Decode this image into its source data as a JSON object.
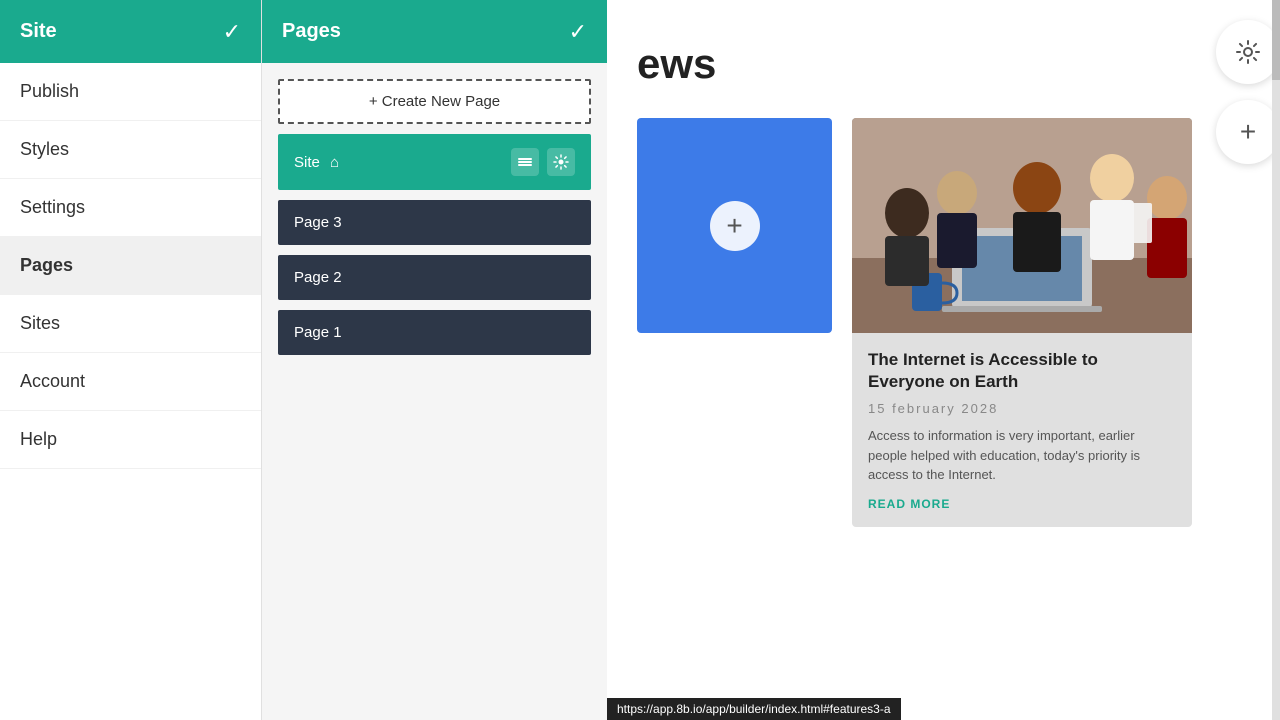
{
  "sidebar": {
    "title": "Site",
    "check": "✓",
    "items": [
      {
        "id": "publish",
        "label": "Publish",
        "active": false
      },
      {
        "id": "styles",
        "label": "Styles",
        "active": false
      },
      {
        "id": "settings",
        "label": "Settings",
        "active": false
      },
      {
        "id": "pages",
        "label": "Pages",
        "active": true
      },
      {
        "id": "sites",
        "label": "Sites",
        "active": false
      },
      {
        "id": "account",
        "label": "Account",
        "active": false
      },
      {
        "id": "help",
        "label": "Help",
        "active": false
      }
    ]
  },
  "pages_panel": {
    "title": "Pages",
    "check": "✓",
    "create_btn_label": "+ Create New Page",
    "pages": [
      {
        "id": "site",
        "label": "Site",
        "is_site": true
      },
      {
        "id": "page3",
        "label": "Page 3",
        "is_site": false
      },
      {
        "id": "page2",
        "label": "Page 2",
        "is_site": false
      },
      {
        "id": "page1",
        "label": "Page 1",
        "is_site": false
      }
    ]
  },
  "main": {
    "title": "ews",
    "card_photo": {
      "title": "The Internet is Accessible to Everyone on Earth",
      "date": "15 february 2028",
      "text": "Access to information is very important, earlier people helped with education, today's priority is access to the Internet.",
      "read_more": "READ MORE"
    },
    "card_blue_plus": "+",
    "add_button_label": "+",
    "status_bar_url": "https://app.8b.io/app/builder/index.html#features3-a"
  },
  "icons": {
    "gear": "⚙",
    "layers": "⊞",
    "home": "⌂",
    "check": "✓",
    "plus": "+"
  },
  "colors": {
    "teal": "#1aaa8e",
    "dark_nav": "#2d3748",
    "card_blue": "#3d7be8"
  }
}
